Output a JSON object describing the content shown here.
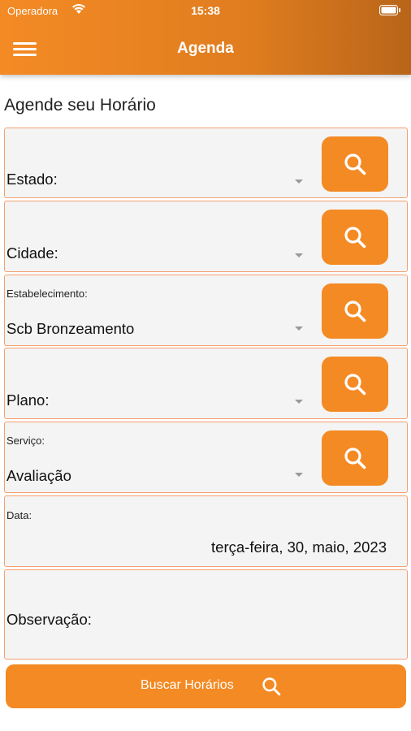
{
  "status_bar": {
    "carrier": "Operadora",
    "time": "15:38"
  },
  "header": {
    "title": "Agenda",
    "menu_icon": "hamburger-menu-icon"
  },
  "page_title": "Agende seu Horário",
  "fields": {
    "estado": {
      "label": "Estado:"
    },
    "cidade": {
      "label": "Cidade:"
    },
    "estabelecimento": {
      "label": "Estabelecimento:",
      "value": "Scb Bronzeamento"
    },
    "plano": {
      "label": "Plano:"
    },
    "servico": {
      "label": "Serviço:",
      "value": "Avaliação"
    },
    "data": {
      "label": "Data:",
      "value": "terça-feira, 30, maio, 2023"
    },
    "observacao": {
      "label": "Observação:"
    }
  },
  "search_icon": "search-icon",
  "buscar_button": {
    "label": "Buscar Horários",
    "icon": "search-icon"
  },
  "colors": {
    "accent": "#f48a24",
    "header_dark": "#b86519",
    "field_bg": "#f4f4f4",
    "field_border": "#f4a070"
  }
}
